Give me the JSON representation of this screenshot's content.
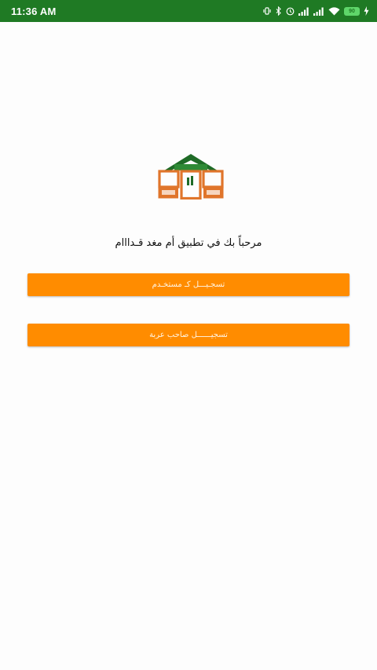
{
  "status_bar": {
    "time": "11:36 AM",
    "battery_level": "90",
    "icons": [
      "vibrate-icon",
      "bluetooth-icon",
      "alarm-icon",
      "signal-icon",
      "signal-icon",
      "wifi-icon",
      "battery-icon",
      "charging-icon"
    ]
  },
  "main": {
    "welcome_text": "مرحباً بك في تطبيق أم مغد قـدااام",
    "register_user_label": "تسجـيـــل كـ مستخـدم",
    "register_car_owner_label": "تسجيــــــل صاحب عربة"
  },
  "colors": {
    "status_bar": "#1f7a24",
    "accent": "#ff8c00",
    "logo_green": "#1f6b27",
    "logo_orange": "#e0752b"
  }
}
